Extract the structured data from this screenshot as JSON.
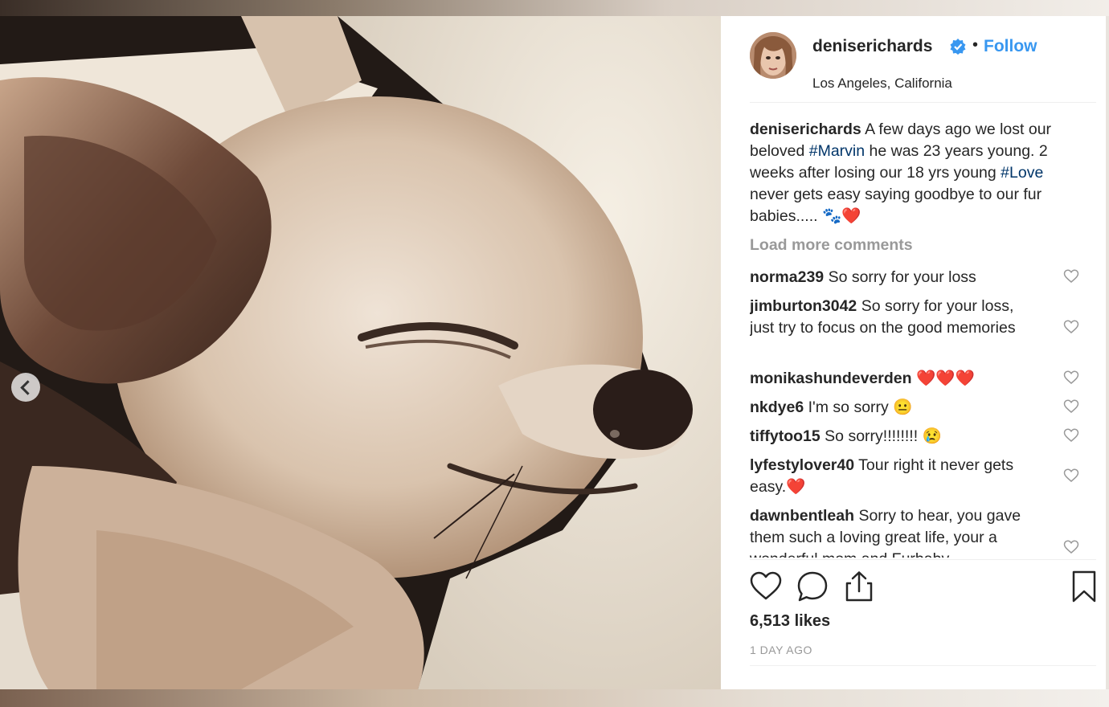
{
  "post": {
    "username": "deniserichards",
    "follow_label": "Follow",
    "location": "Los Angeles, California"
  },
  "caption": {
    "username": "deniserichards",
    "part1": "A few days ago we lost our beloved ",
    "hashtag1": "#Marvin",
    "part2": " he was 23 years young. 2 weeks after losing our 18 yrs young ",
    "hashtag2": "#Love",
    "part3": " never gets easy saying goodbye to our fur babies..... 🐾❤️"
  },
  "load_more_label": "Load more comments",
  "comments": [
    {
      "user": "norma239",
      "text": "So sorry for your loss"
    },
    {
      "user": "jimburton3042",
      "text": "So sorry for your loss, just try to focus on the good memories"
    },
    {
      "user": "monikashundeverden",
      "text": "❤️❤️❤️"
    },
    {
      "user": "nkdye6",
      "text": "I'm so sorry 😐"
    },
    {
      "user": "tiffytoo15",
      "text": "So sorry!!!!!!!! 😢"
    },
    {
      "user": "lyfestylover40",
      "text": "Tour right it never gets easy.❤️"
    },
    {
      "user": "dawnbentleah",
      "text": "Sorry to hear, you gave them such a loving great life, your a wonderful mom and Furbaby"
    }
  ],
  "likes": "6,513 likes",
  "timestamp": "1 DAY AGO",
  "icons": {
    "verified": "verified-badge-icon",
    "like": "heart-icon",
    "comment": "comment-bubble-icon",
    "share": "share-icon",
    "save": "bookmark-icon",
    "prev": "chevron-left-icon"
  },
  "colors": {
    "link_blue": "#3897f0",
    "hashtag": "#003569",
    "muted": "#999999",
    "text": "#262626"
  }
}
